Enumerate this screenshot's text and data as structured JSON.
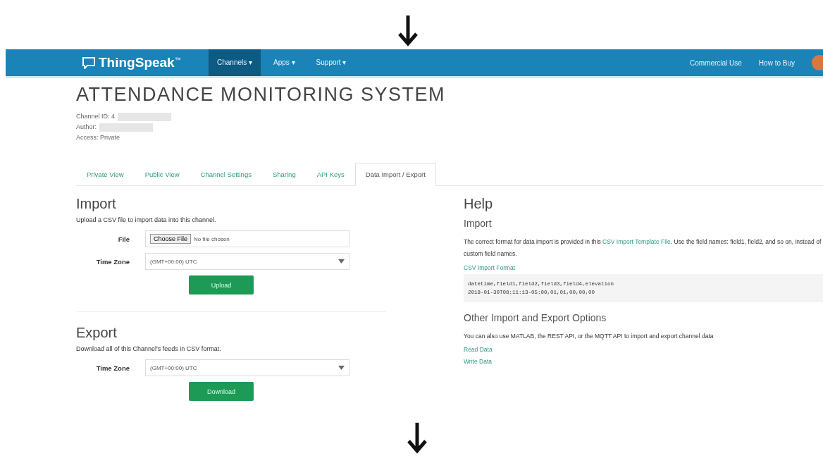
{
  "brand": {
    "name": "ThingSpeak",
    "mark": "™"
  },
  "nav": {
    "items": [
      {
        "label": "Channels ▾",
        "selected": true
      },
      {
        "label": "Apps ▾",
        "selected": false
      },
      {
        "label": "Support ▾",
        "selected": false
      }
    ],
    "right": [
      "Commercial Use",
      "How to Buy"
    ]
  },
  "channel": {
    "title": "ATTENDANCE MONITORING SYSTEM",
    "info": [
      {
        "label": "Channel ID: 4",
        "redacted": true
      },
      {
        "label": "Author:",
        "redacted": true
      },
      {
        "label": "Access: Private",
        "redacted": false
      }
    ]
  },
  "tabs": [
    {
      "label": "Private View",
      "selected": false
    },
    {
      "label": "Public View",
      "selected": false
    },
    {
      "label": "Channel Settings",
      "selected": false
    },
    {
      "label": "Sharing",
      "selected": false
    },
    {
      "label": "API Keys",
      "selected": false
    },
    {
      "label": "Data Import / Export",
      "selected": true
    }
  ],
  "import": {
    "heading": "Import",
    "description": "Upload a CSV file to import data into this channel.",
    "file_label": "File",
    "file_button": "Choose File",
    "file_status": "No file chosen",
    "timezone_label": "Time Zone",
    "timezone_value": "(GMT+00:00) UTC",
    "button": "Upload"
  },
  "export": {
    "heading": "Export",
    "description": "Download all of this Channel's feeds in CSV format.",
    "timezone_label": "Time Zone",
    "timezone_value": "(GMT+00:00) UTC",
    "button": "Download"
  },
  "help": {
    "heading": "Help",
    "import_heading": "Import",
    "import_text_before": "The correct format for data import is provided in this ",
    "import_link": "CSV Import Template File",
    "import_text_after": ". Use the field names: field1, field2, and so on, instead of custom field names.",
    "format_label": "CSV Import Format",
    "format_lines": [
      "datetime,field1,field2,field3,field4,elevation",
      "2018-01-30T08:11:13-05:00,01,01,00,00,00"
    ],
    "other_heading": "Other Import and Export Options",
    "other_text": "You can also use MATLAB, the REST API, or the MQTT API to import and export channel data",
    "links": [
      "Read Data",
      "Write Data"
    ]
  }
}
